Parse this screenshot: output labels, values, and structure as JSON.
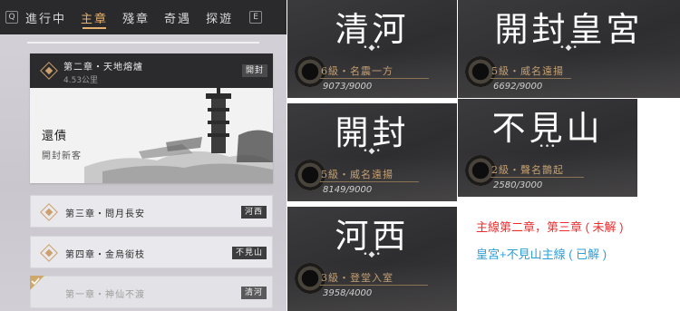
{
  "tabbar": {
    "left_key": "Q",
    "right_key": "E",
    "tabs": [
      "進行中",
      "主章",
      "殘章",
      "奇遇",
      "探遊"
    ],
    "active_index": 1
  },
  "current_chapter": {
    "title": "第二章・天地熔爐",
    "distance": "4.53公里",
    "location": "開封",
    "quest_name": "還債",
    "quest_giver": "開封新客"
  },
  "chapter_rows": [
    {
      "title": "第三章・問月長安",
      "location": "河西"
    },
    {
      "title": "第四章・金烏銜枝",
      "location": "不見山"
    },
    {
      "title": "第一章・神仙不渡",
      "location": "清河",
      "completed": true
    }
  ],
  "locations": {
    "qinghe": {
      "name": "清河",
      "deco": "•◆•",
      "rank": "6級・名震一方",
      "progress": "9073/9000",
      "fill": 1.0
    },
    "palace": {
      "name": "開封皇宮",
      "deco": "•◆•",
      "rank": "5級・威名遠揚",
      "progress": "6692/9000",
      "fill": 0.74
    },
    "kaifeng": {
      "name": "開封",
      "deco": "•◆•",
      "rank": "5級・威名遠揚",
      "progress": "8149/9000",
      "fill": 0.91
    },
    "bujian": {
      "name": "不見山",
      "deco": "•••",
      "rank": "2級・聲名鵲起",
      "progress": "2580/3000",
      "fill": 0.86
    },
    "hexi": {
      "name": "河西",
      "deco": "•◆•",
      "rank": "3級・登堂入室",
      "progress": "3958/4000",
      "fill": 0.99
    }
  },
  "notes": {
    "red": "主線第二章，第三章 ( 未解 )",
    "blue": "皇宮+不見山主線 ( 已解 )"
  },
  "colors": {
    "accent_gold": "#e3b06f",
    "note_red": "#ee2e2e",
    "note_blue": "#2a9fd8"
  },
  "icons": [
    "diamond-icon",
    "check-icon",
    "reputation-badge-icon",
    "pagoda-illustration"
  ]
}
